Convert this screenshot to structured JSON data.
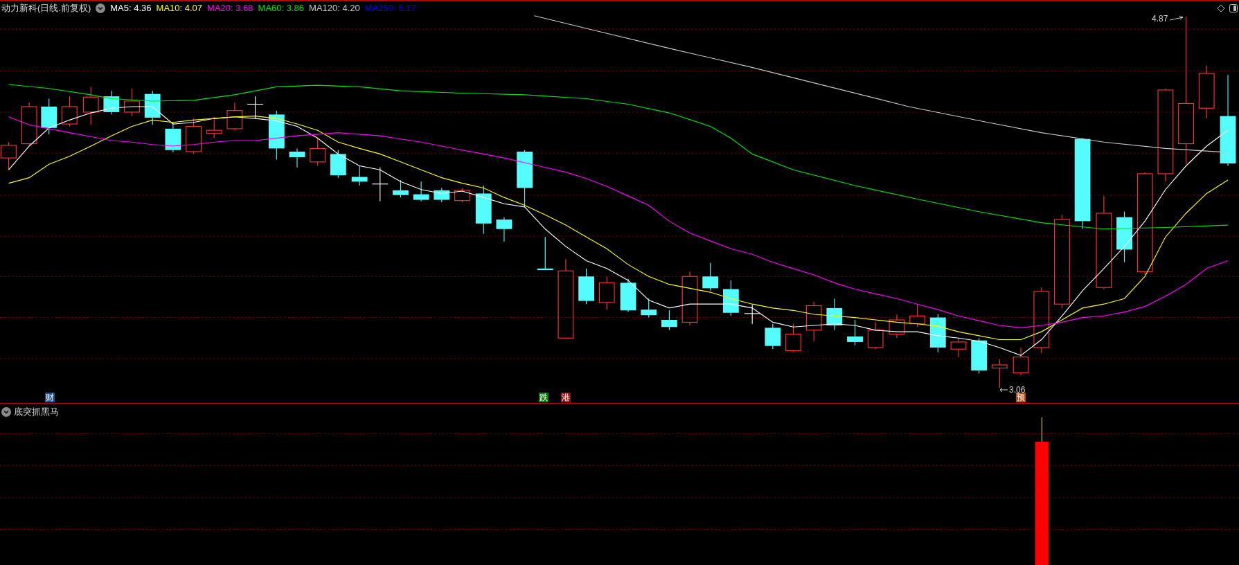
{
  "stock": {
    "title": "动力新科(日线.前复权)",
    "indicators": [
      {
        "label": "MA5: 4.36",
        "color": "#ffffff"
      },
      {
        "label": "MA10: 4.07",
        "color": "#ffff00"
      },
      {
        "label": "MA20: 3.68",
        "color": "#ff00ff"
      },
      {
        "label": "MA60: 3.86",
        "color": "#00e600"
      },
      {
        "label": "MA120: 4.20",
        "color": "#c8c8c8"
      },
      {
        "label": "MA250: 5.17",
        "color": "#0000ff"
      }
    ]
  },
  "price_chart": {
    "high_label": "4.87",
    "low_label": "3.06",
    "markers": [
      {
        "text": "财",
        "color": "#1d4f91"
      },
      {
        "text": "跌",
        "color": "#0f7a12"
      },
      {
        "text": "港",
        "color": "#8a1414"
      },
      {
        "text": "预",
        "color": "#b5470c"
      }
    ]
  },
  "indicator_panel": {
    "title": "底突抓黑马"
  }
}
